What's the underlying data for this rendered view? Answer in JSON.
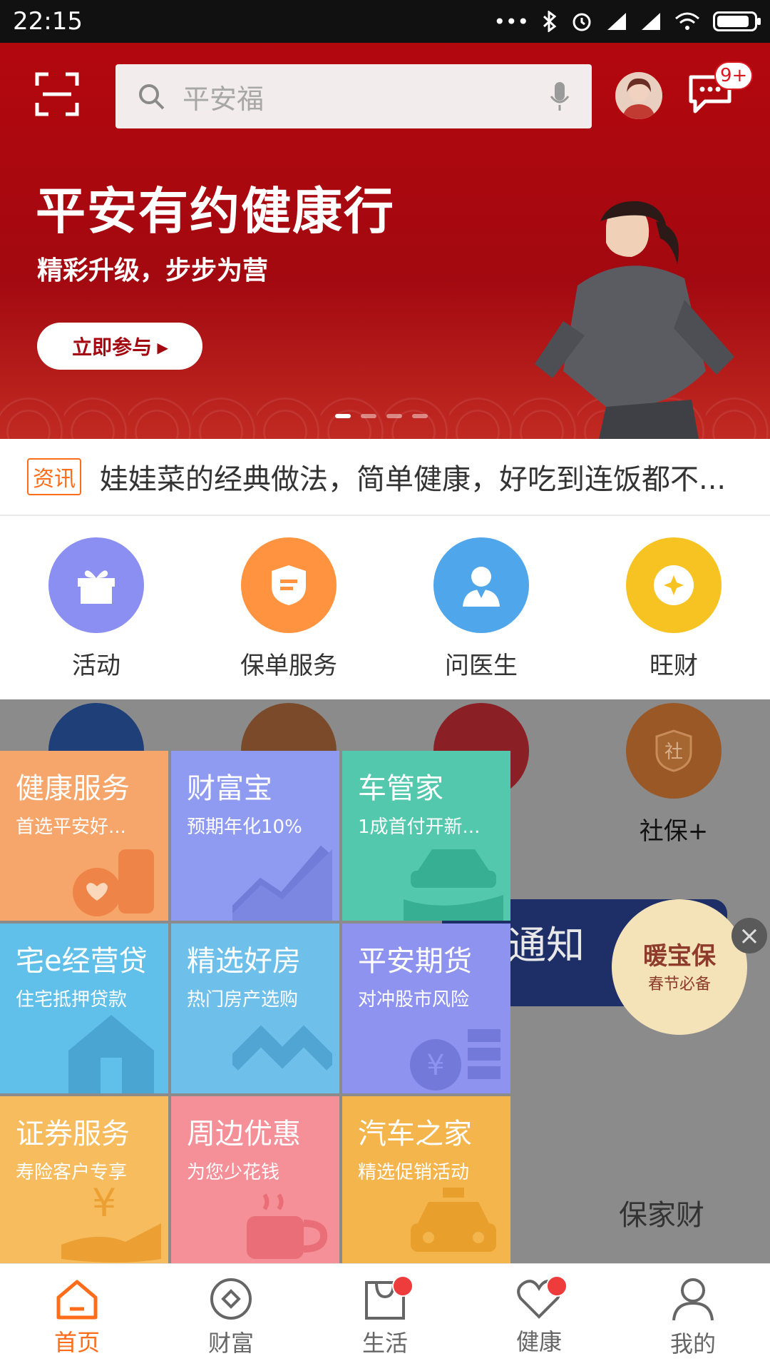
{
  "status": {
    "time": "22:15"
  },
  "header": {
    "search_placeholder": "平安福",
    "message_badge": "9+"
  },
  "hero": {
    "title": "平安有约健康行",
    "subtitle": "精彩升级，步步为营",
    "button": "立即参与 ▸"
  },
  "news": {
    "tag": "资讯",
    "text": "娃娃菜的经典做法，简单健康，好吃到连饭都不..."
  },
  "quick": [
    {
      "label": "活动",
      "color": "#8c8ff2",
      "icon": "gift-icon"
    },
    {
      "label": "保单服务",
      "color": "#ff9340",
      "icon": "shield-icon"
    },
    {
      "label": "问医生",
      "color": "#4fa6ea",
      "icon": "doctor-icon"
    },
    {
      "label": "旺财",
      "color": "#f6c322",
      "icon": "coin-icon"
    }
  ],
  "under": {
    "row2_label": "社保+",
    "row2_icon_text": "社",
    "banner_text": "通知",
    "warm_title": "暖宝保",
    "warm_sub": "春节必备",
    "bottom_label": "保家财"
  },
  "tiles": [
    {
      "title": "健康服务",
      "sub": "首选平安好...",
      "color": "#f7a66b",
      "icon": "health-icon"
    },
    {
      "title": "财富宝",
      "sub": "预期年化10%",
      "color": "#8f9bf0",
      "icon": "chart-icon"
    },
    {
      "title": "车管家",
      "sub": "1成首付开新...",
      "color": "#53c8ad",
      "icon": "car-icon"
    },
    {
      "title": "宅e经营贷",
      "sub": "住宅抵押贷款",
      "color": "#61c0ea",
      "icon": "house-icon"
    },
    {
      "title": "精选好房",
      "sub": "热门房产选购",
      "color": "#6ec0ea",
      "icon": "roof-icon"
    },
    {
      "title": "平安期货",
      "sub": "对冲股市风险",
      "color": "#8d93ef",
      "icon": "coins-icon"
    },
    {
      "title": "证券服务",
      "sub": "寿险客户专享",
      "color": "#f6bc5d",
      "icon": "hand-yen-icon"
    },
    {
      "title": "周边优惠",
      "sub": "为您少花钱",
      "color": "#f58f98",
      "icon": "cup-icon"
    },
    {
      "title": "汽车之家",
      "sub": "精选促销活动",
      "color": "#f4b54d",
      "icon": "taxi-icon"
    }
  ],
  "tabs": [
    {
      "label": "首页",
      "icon": "home-icon",
      "active": true
    },
    {
      "label": "财富",
      "icon": "wealth-icon"
    },
    {
      "label": "生活",
      "icon": "bag-icon",
      "badge": true
    },
    {
      "label": "健康",
      "icon": "heart-icon",
      "badge": true
    },
    {
      "label": "我的",
      "icon": "user-icon"
    }
  ]
}
